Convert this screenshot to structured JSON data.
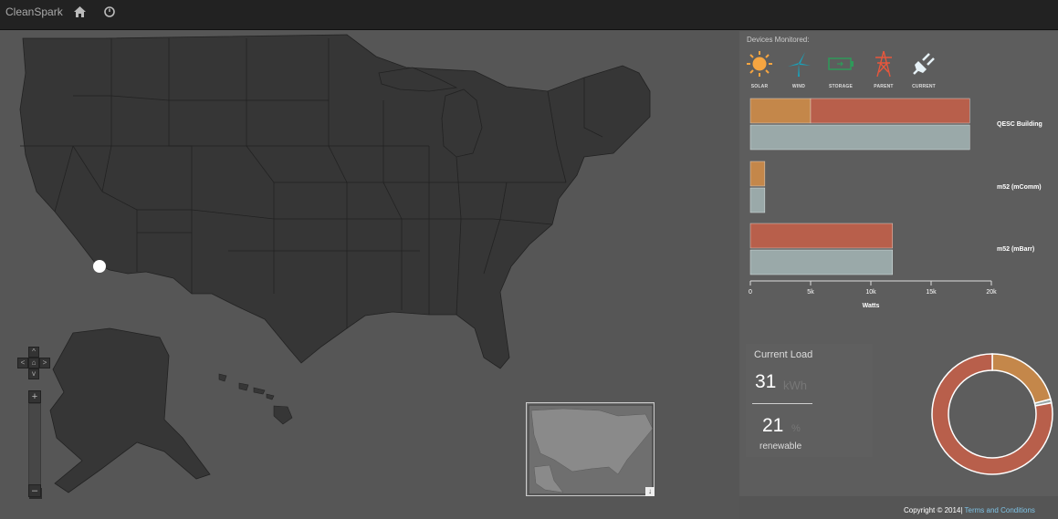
{
  "app": {
    "brand": "CleanSpark"
  },
  "nav": {
    "home_icon": "home-icon",
    "dashboard_icon": "gauge-icon"
  },
  "devices": {
    "title": "Devices Monitored:",
    "items": [
      {
        "label": "SOLAR",
        "icon": "sun-icon",
        "color": "#f5a541"
      },
      {
        "label": "WIND",
        "icon": "wind-turbine-icon",
        "color": "#1aa0b8"
      },
      {
        "label": "STORAGE",
        "icon": "battery-icon",
        "color": "#2f9a5a"
      },
      {
        "label": "PARENT",
        "icon": "transmission-tower-icon",
        "color": "#e8573c"
      },
      {
        "label": "CURRENT",
        "icon": "plug-icon",
        "color": "#e6f1f6"
      }
    ]
  },
  "chart_data": {
    "type": "bar",
    "orientation": "horizontal",
    "categories": [
      "QESC Building",
      "m52 (mComm)",
      "m52 (mBarr)"
    ],
    "series": [
      {
        "values": [
          5000,
          1200,
          0
        ],
        "color": "#c4874a"
      },
      {
        "values": [
          13200,
          0,
          11800
        ],
        "color": "#b85f4b"
      },
      {
        "values": [
          18200,
          1200,
          11800
        ],
        "color": "#9aa9a9"
      }
    ],
    "xlabel": "Watts",
    "xlim": [
      0,
      20000
    ],
    "ticks": [
      "0",
      "5k",
      "10k",
      "15k",
      "20k"
    ],
    "donut": {
      "type": "pie",
      "slices": [
        {
          "value": 21,
          "color": "#c4874a"
        },
        {
          "value": 1,
          "color": "#9aa9a9"
        },
        {
          "value": 78,
          "color": "#b85f4b"
        }
      ]
    }
  },
  "load": {
    "title": "Current Load",
    "value": "31",
    "unit": "kWh",
    "renewable_value": "21",
    "renewable_unit": "%",
    "renewable_label": "renewable"
  },
  "map": {
    "marker_color": "#ffffff",
    "land_color": "#373737",
    "zoom_in": "+",
    "zoom_out": "–"
  },
  "footer": {
    "copyright": "Copyright © 2014|",
    "terms": "Terms and Conditions"
  }
}
